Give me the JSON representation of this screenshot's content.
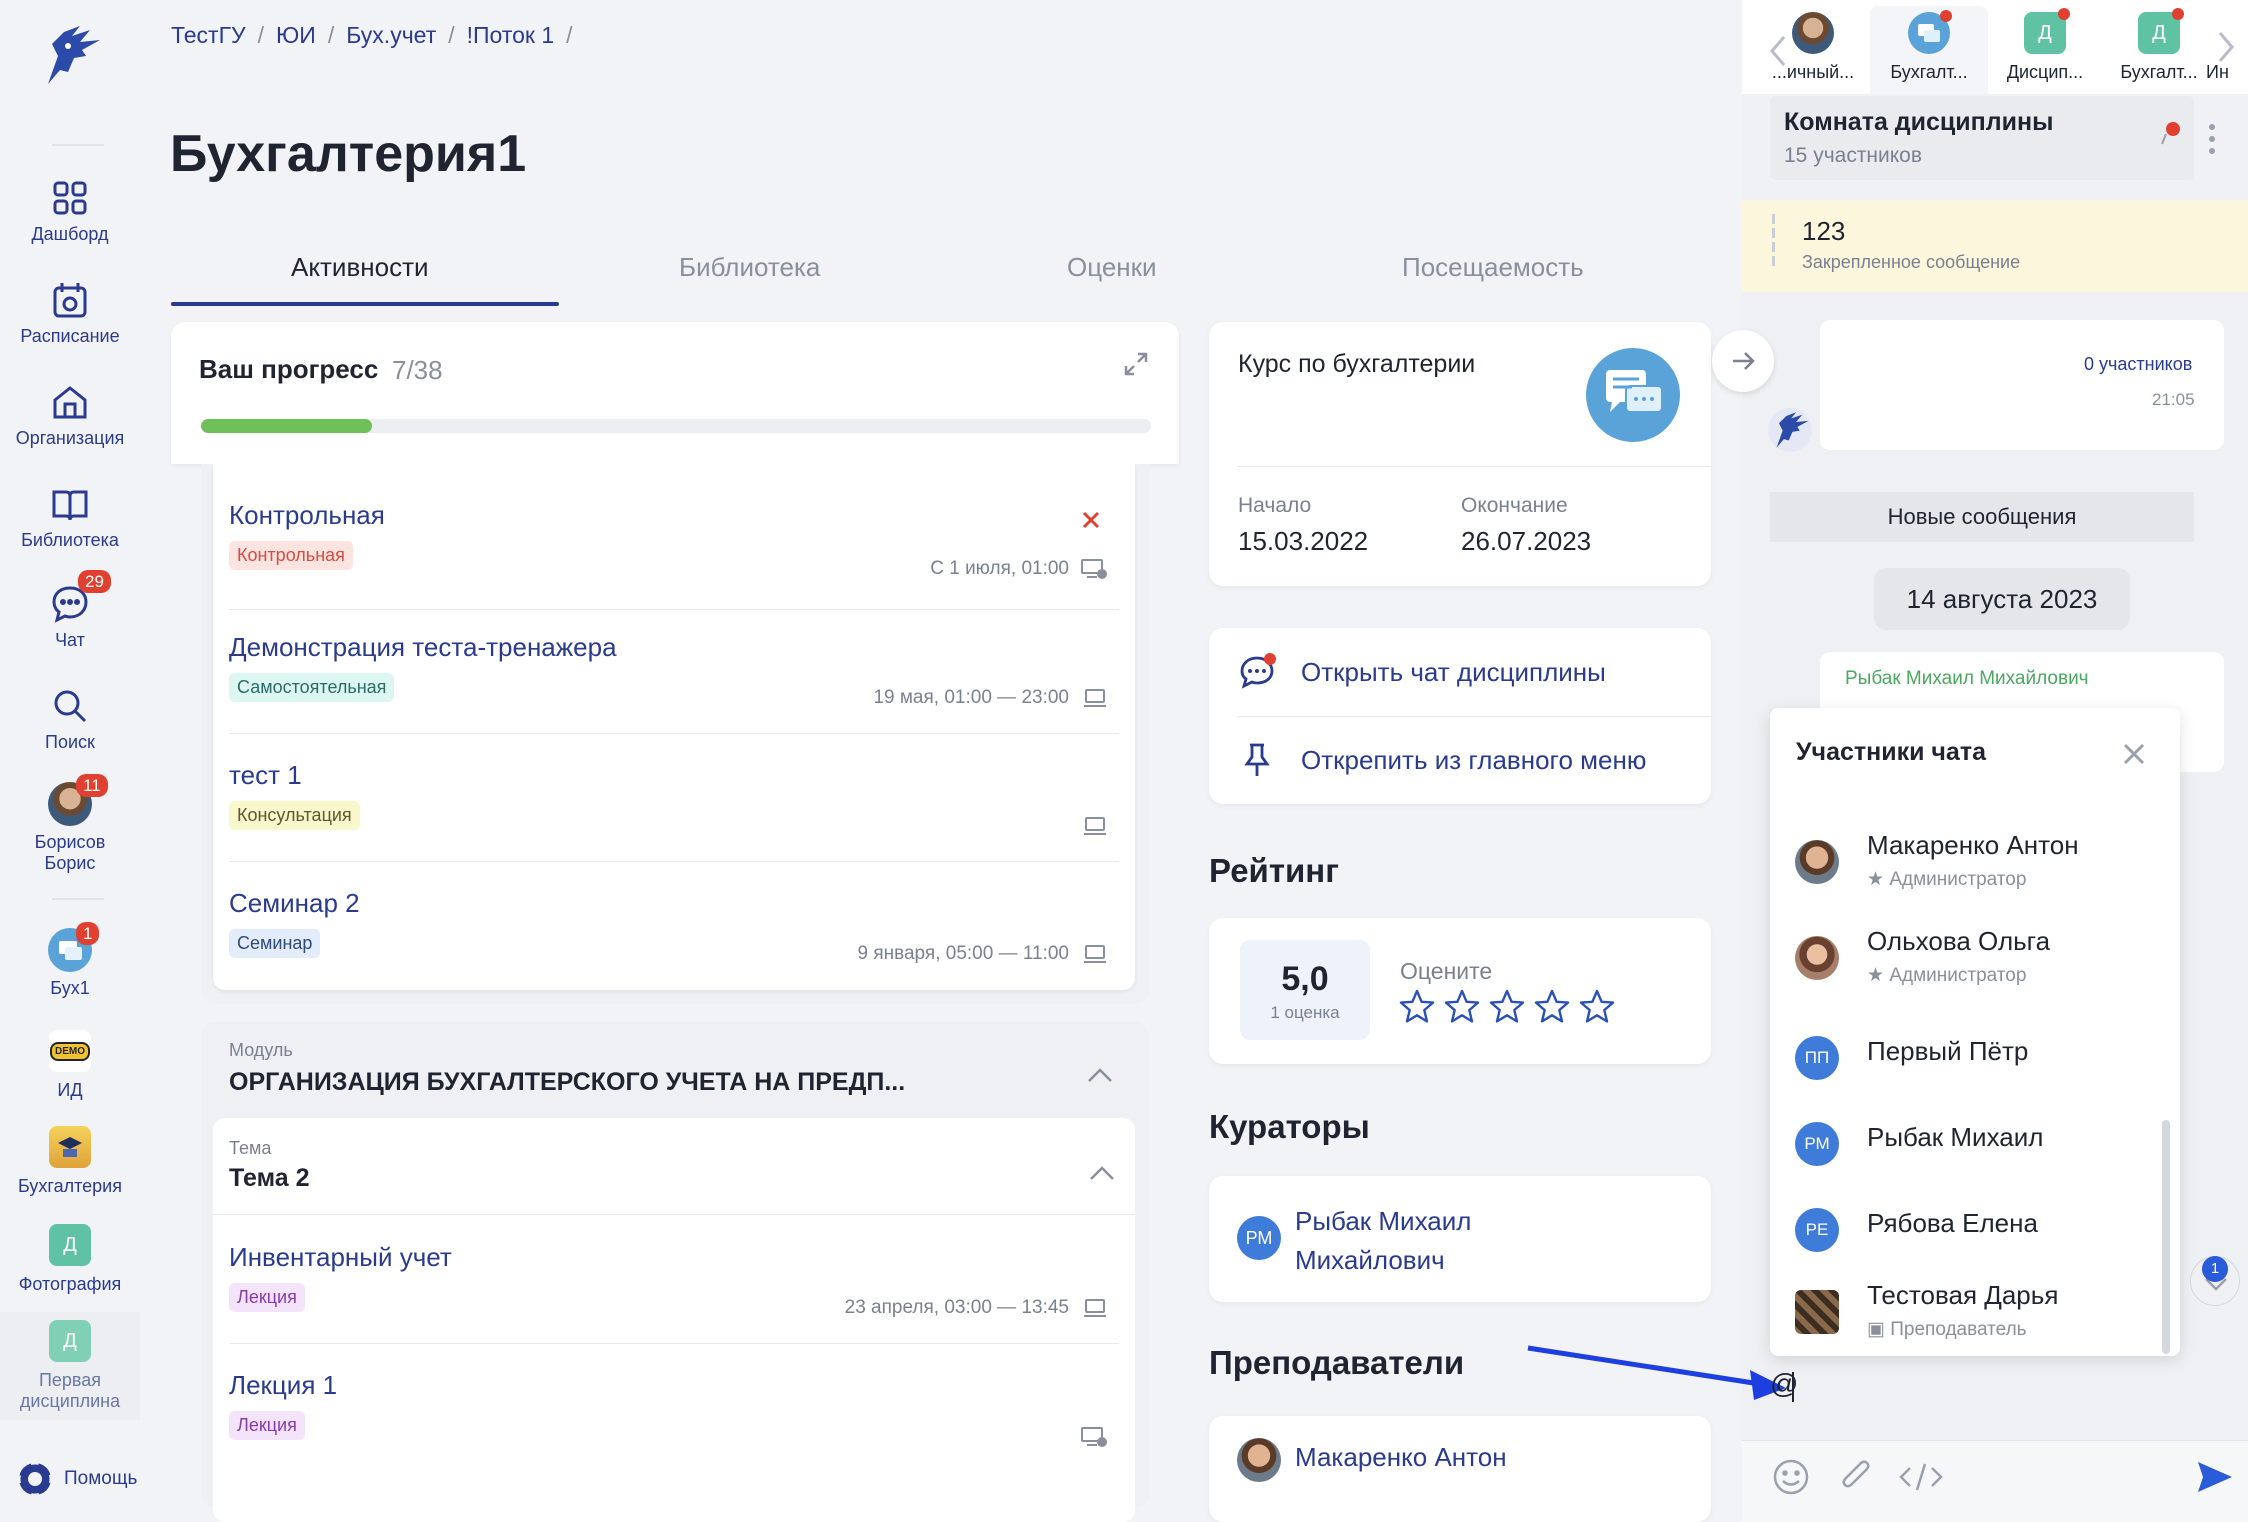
{
  "breadcrumbs": [
    "ТестГУ",
    "ЮИ",
    "Бух.учет",
    "!Поток 1"
  ],
  "page_title": "Бухгалтерия1",
  "tabs": {
    "activities": "Активности",
    "library": "Библиотека",
    "grades": "Оценки",
    "attendance": "Посещаемость"
  },
  "sidebar": {
    "dashboard": "Дашборд",
    "schedule": "Расписание",
    "organization": "Организация",
    "library": "Библиотека",
    "chat": "Чат",
    "chat_badge": "29",
    "search": "Поиск",
    "user_name": "Борисов Борис",
    "user_badge": "11",
    "buh1": "Бух1",
    "buh1_badge": "1",
    "id": "ИД",
    "id_logo": "DEMO",
    "buhgalteria": "Бухгалтерия",
    "photo": "Фотография",
    "photo_letter": "Д",
    "first_disc": "Первая дисциплина",
    "first_letter": "Д",
    "help": "Помощь"
  },
  "progress": {
    "title": "Ваш прогресс",
    "count": "7/38",
    "fraction": 0.18
  },
  "activities": [
    {
      "name": "Контрольная",
      "tag": "Контрольная",
      "date": "С 1 июля, 01:00"
    },
    {
      "name": "Демонстрация теста-тренажера",
      "tag": "Самостоятельная",
      "date": "19 мая, 01:00 — 23:00"
    },
    {
      "name": "тест 1",
      "tag": "Консультация",
      "date": ""
    },
    {
      "name": "Семинар 2",
      "tag": "Семинар",
      "date": "9 января, 05:00 — 11:00"
    }
  ],
  "module": {
    "label": "Модуль",
    "title": "ОРГАНИЗАЦИЯ БУХГАЛТЕРСКОГО УЧЕТА НА ПРЕДП..."
  },
  "theme": {
    "label": "Тема",
    "title": "Тема 2"
  },
  "theme_activities": [
    {
      "name": "Инвентарный учет",
      "tag": "Лекция",
      "date": "23 апреля, 03:00 — 13:45"
    },
    {
      "name": "Лекция 1",
      "tag": "Лекция",
      "date": ""
    }
  ],
  "course": {
    "title": "Курс по бухгалтерии",
    "start_label": "Начало",
    "start": "15.03.2022",
    "end_label": "Окончание",
    "end": "26.07.2023"
  },
  "chat_actions": {
    "open": "Открыть чат дисциплины",
    "unpin": "Открепить из главного меню"
  },
  "rating": {
    "heading": "Рейтинг",
    "value": "5,0",
    "count": "1 оценка",
    "rate_label": "Оцените",
    "stars": 5
  },
  "curators": {
    "heading": "Кураторы",
    "initials": "РМ",
    "name_line1": "Рыбак Михаил",
    "name_line2": "Михайлович"
  },
  "teachers": {
    "heading": "Преподаватели",
    "name": "Макаренко Антон"
  },
  "chat_panel": {
    "tabs": [
      "...ичный...",
      "Бухгалт...",
      "Дисцип...",
      "Бухгалт...",
      "Ин"
    ],
    "tab_letters": [
      "Д",
      "Д"
    ],
    "room_title": "Комната дисциплины",
    "room_members": "15 участников",
    "pinned_text": "123",
    "pinned_label": "Закрепленное сообщение",
    "msg_participants": "0 участников",
    "msg_time": "21:05",
    "new_messages": "Новые сообщения",
    "date_chip": "14 августа 2023",
    "sender": "Рыбак Михаил Михайлович",
    "popup_title": "Участники чата",
    "members": [
      {
        "name": "Макаренко Антон",
        "role": "Администратор",
        "initials": ""
      },
      {
        "name": "Ольхова Ольга",
        "role": "Администратор",
        "initials": ""
      },
      {
        "name": "Первый Пётр",
        "role": "",
        "initials": "ПП"
      },
      {
        "name": "Рыбак Михаил",
        "role": "",
        "initials": "РМ"
      },
      {
        "name": "Рябова Елена",
        "role": "",
        "initials": "РЕ"
      },
      {
        "name": "Тестовая Дарья",
        "role": "Преподаватель",
        "initials": ""
      }
    ],
    "input_value": "@",
    "scroll_badge": "1"
  },
  "colors": {
    "accent": "#2a3b8f",
    "badge": "#e0402f",
    "progress": "#6fbf5a",
    "avatar_blue": "#3f7bd9",
    "annotation_arrow": "#1d3fe0"
  }
}
